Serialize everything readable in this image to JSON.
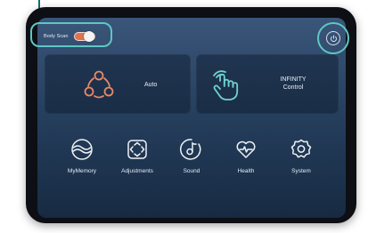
{
  "header": {
    "body_scan_label": "Body Scan",
    "body_scan_enabled": true,
    "power_icon": "power-icon"
  },
  "tiles": [
    {
      "icon": "auto-mode-icon",
      "label": "Auto"
    },
    {
      "icon": "hand-touch-icon",
      "label_line1": "INFINITY",
      "label_line2": "Control"
    }
  ],
  "menu": [
    {
      "icon": "memory-icon",
      "label": "MyMemory"
    },
    {
      "icon": "adjustments-icon",
      "label": "Adjustments"
    },
    {
      "icon": "music-note-icon",
      "label": "Sound"
    },
    {
      "icon": "heart-pulse-icon",
      "label": "Health"
    },
    {
      "icon": "settings-icon",
      "label": "System"
    }
  ],
  "colors": {
    "accent_orange": "#e0734f",
    "highlight_teal": "#5ec7c4",
    "screen_top": "#3a5679",
    "screen_bottom": "#172a42"
  }
}
